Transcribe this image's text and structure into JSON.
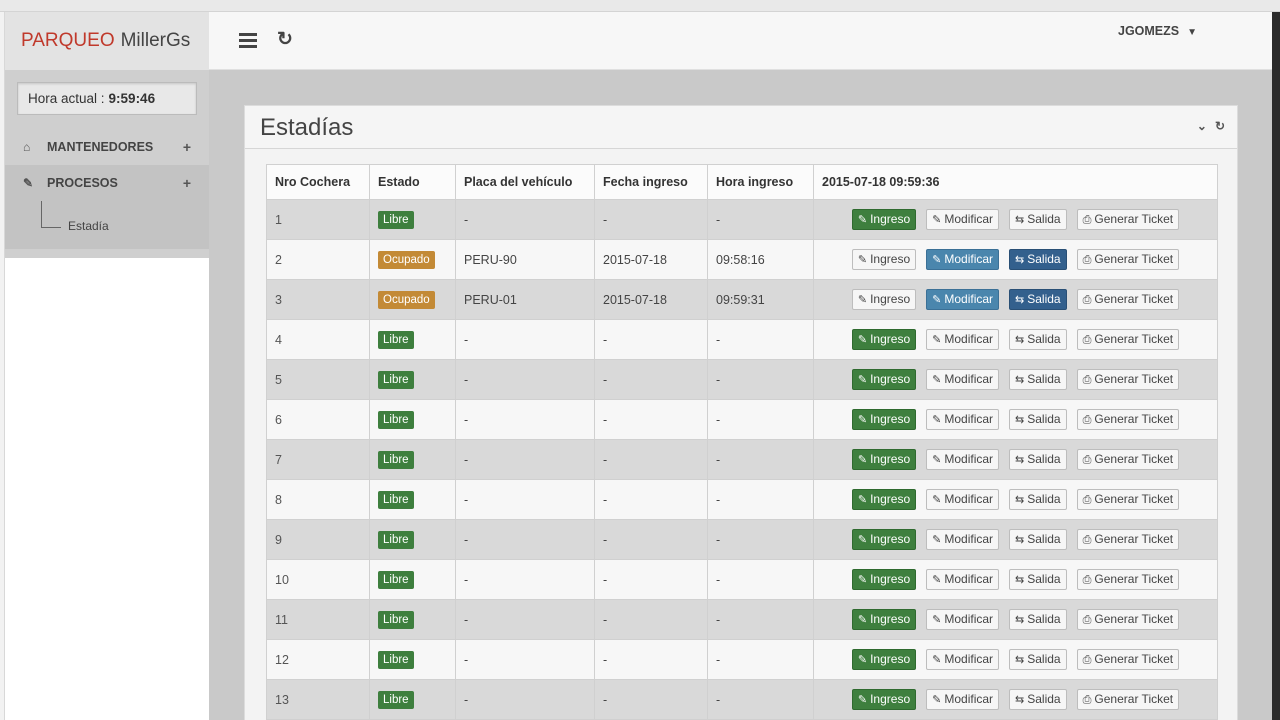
{
  "brand": {
    "part1": "PARQUEO",
    "part2": "MillerGs"
  },
  "clock": {
    "label": "Hora actual :",
    "time": "9:59:46"
  },
  "menu": {
    "mantenedores": "MANTENEDORES",
    "procesos": "PROCESOS",
    "estadia": "Estadía"
  },
  "user": {
    "name": "JGOMEZS"
  },
  "panel": {
    "title": "Estadías"
  },
  "table": {
    "headers": [
      "Nro Cochera",
      "Estado",
      "Placa del vehículo",
      "Fecha ingreso",
      "Hora ingreso",
      "2015-07-18 09:59:36"
    ],
    "rows": [
      {
        "num": "1",
        "estado": "Libre",
        "placa": "-",
        "fecha": "-",
        "hora": "-"
      },
      {
        "num": "2",
        "estado": "Ocupado",
        "placa": "PERU-90",
        "fecha": "2015-07-18",
        "hora": "09:58:16"
      },
      {
        "num": "3",
        "estado": "Ocupado",
        "placa": "PERU-01",
        "fecha": "2015-07-18",
        "hora": "09:59:31"
      },
      {
        "num": "4",
        "estado": "Libre",
        "placa": "-",
        "fecha": "-",
        "hora": "-"
      },
      {
        "num": "5",
        "estado": "Libre",
        "placa": "-",
        "fecha": "-",
        "hora": "-"
      },
      {
        "num": "6",
        "estado": "Libre",
        "placa": "-",
        "fecha": "-",
        "hora": "-"
      },
      {
        "num": "7",
        "estado": "Libre",
        "placa": "-",
        "fecha": "-",
        "hora": "-"
      },
      {
        "num": "8",
        "estado": "Libre",
        "placa": "-",
        "fecha": "-",
        "hora": "-"
      },
      {
        "num": "9",
        "estado": "Libre",
        "placa": "-",
        "fecha": "-",
        "hora": "-"
      },
      {
        "num": "10",
        "estado": "Libre",
        "placa": "-",
        "fecha": "-",
        "hora": "-"
      },
      {
        "num": "11",
        "estado": "Libre",
        "placa": "-",
        "fecha": "-",
        "hora": "-"
      },
      {
        "num": "12",
        "estado": "Libre",
        "placa": "-",
        "fecha": "-",
        "hora": "-"
      },
      {
        "num": "13",
        "estado": "Libre",
        "placa": "-",
        "fecha": "-",
        "hora": "-"
      }
    ]
  },
  "buttons": {
    "ingreso": "Ingreso",
    "modificar": "Modificar",
    "salida": "Salida",
    "ticket": "Generar Ticket"
  },
  "colors": {
    "libre": "#3e7f3e",
    "ocupado": "#c38a36",
    "modificar_active": "#4a86ad",
    "salida_active": "#33608d",
    "brand_accent": "#c0392b"
  }
}
